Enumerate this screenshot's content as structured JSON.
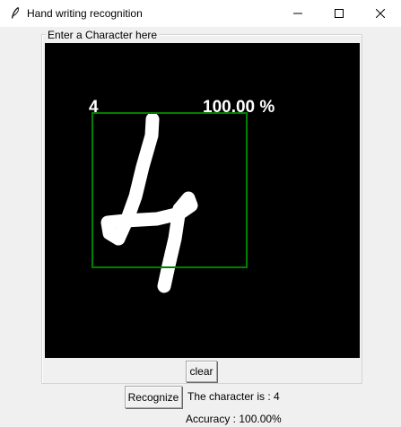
{
  "window": {
    "title": "Hand writing recognition",
    "icon": "feather-icon",
    "controls": [
      "minimize-icon",
      "maximize-icon",
      "close-icon"
    ]
  },
  "frame": {
    "label": "Enter a Character here"
  },
  "canvas": {
    "background": "#000000",
    "stroke_color": "#ffffff",
    "box_color": "#008000",
    "prediction_label": "4",
    "prediction_confidence": "100.00 %"
  },
  "buttons": {
    "clear": "clear",
    "recognize": "Recognize"
  },
  "result": {
    "character_text": "The character is : 4",
    "accuracy_text": "Accuracy : 100.00%"
  }
}
